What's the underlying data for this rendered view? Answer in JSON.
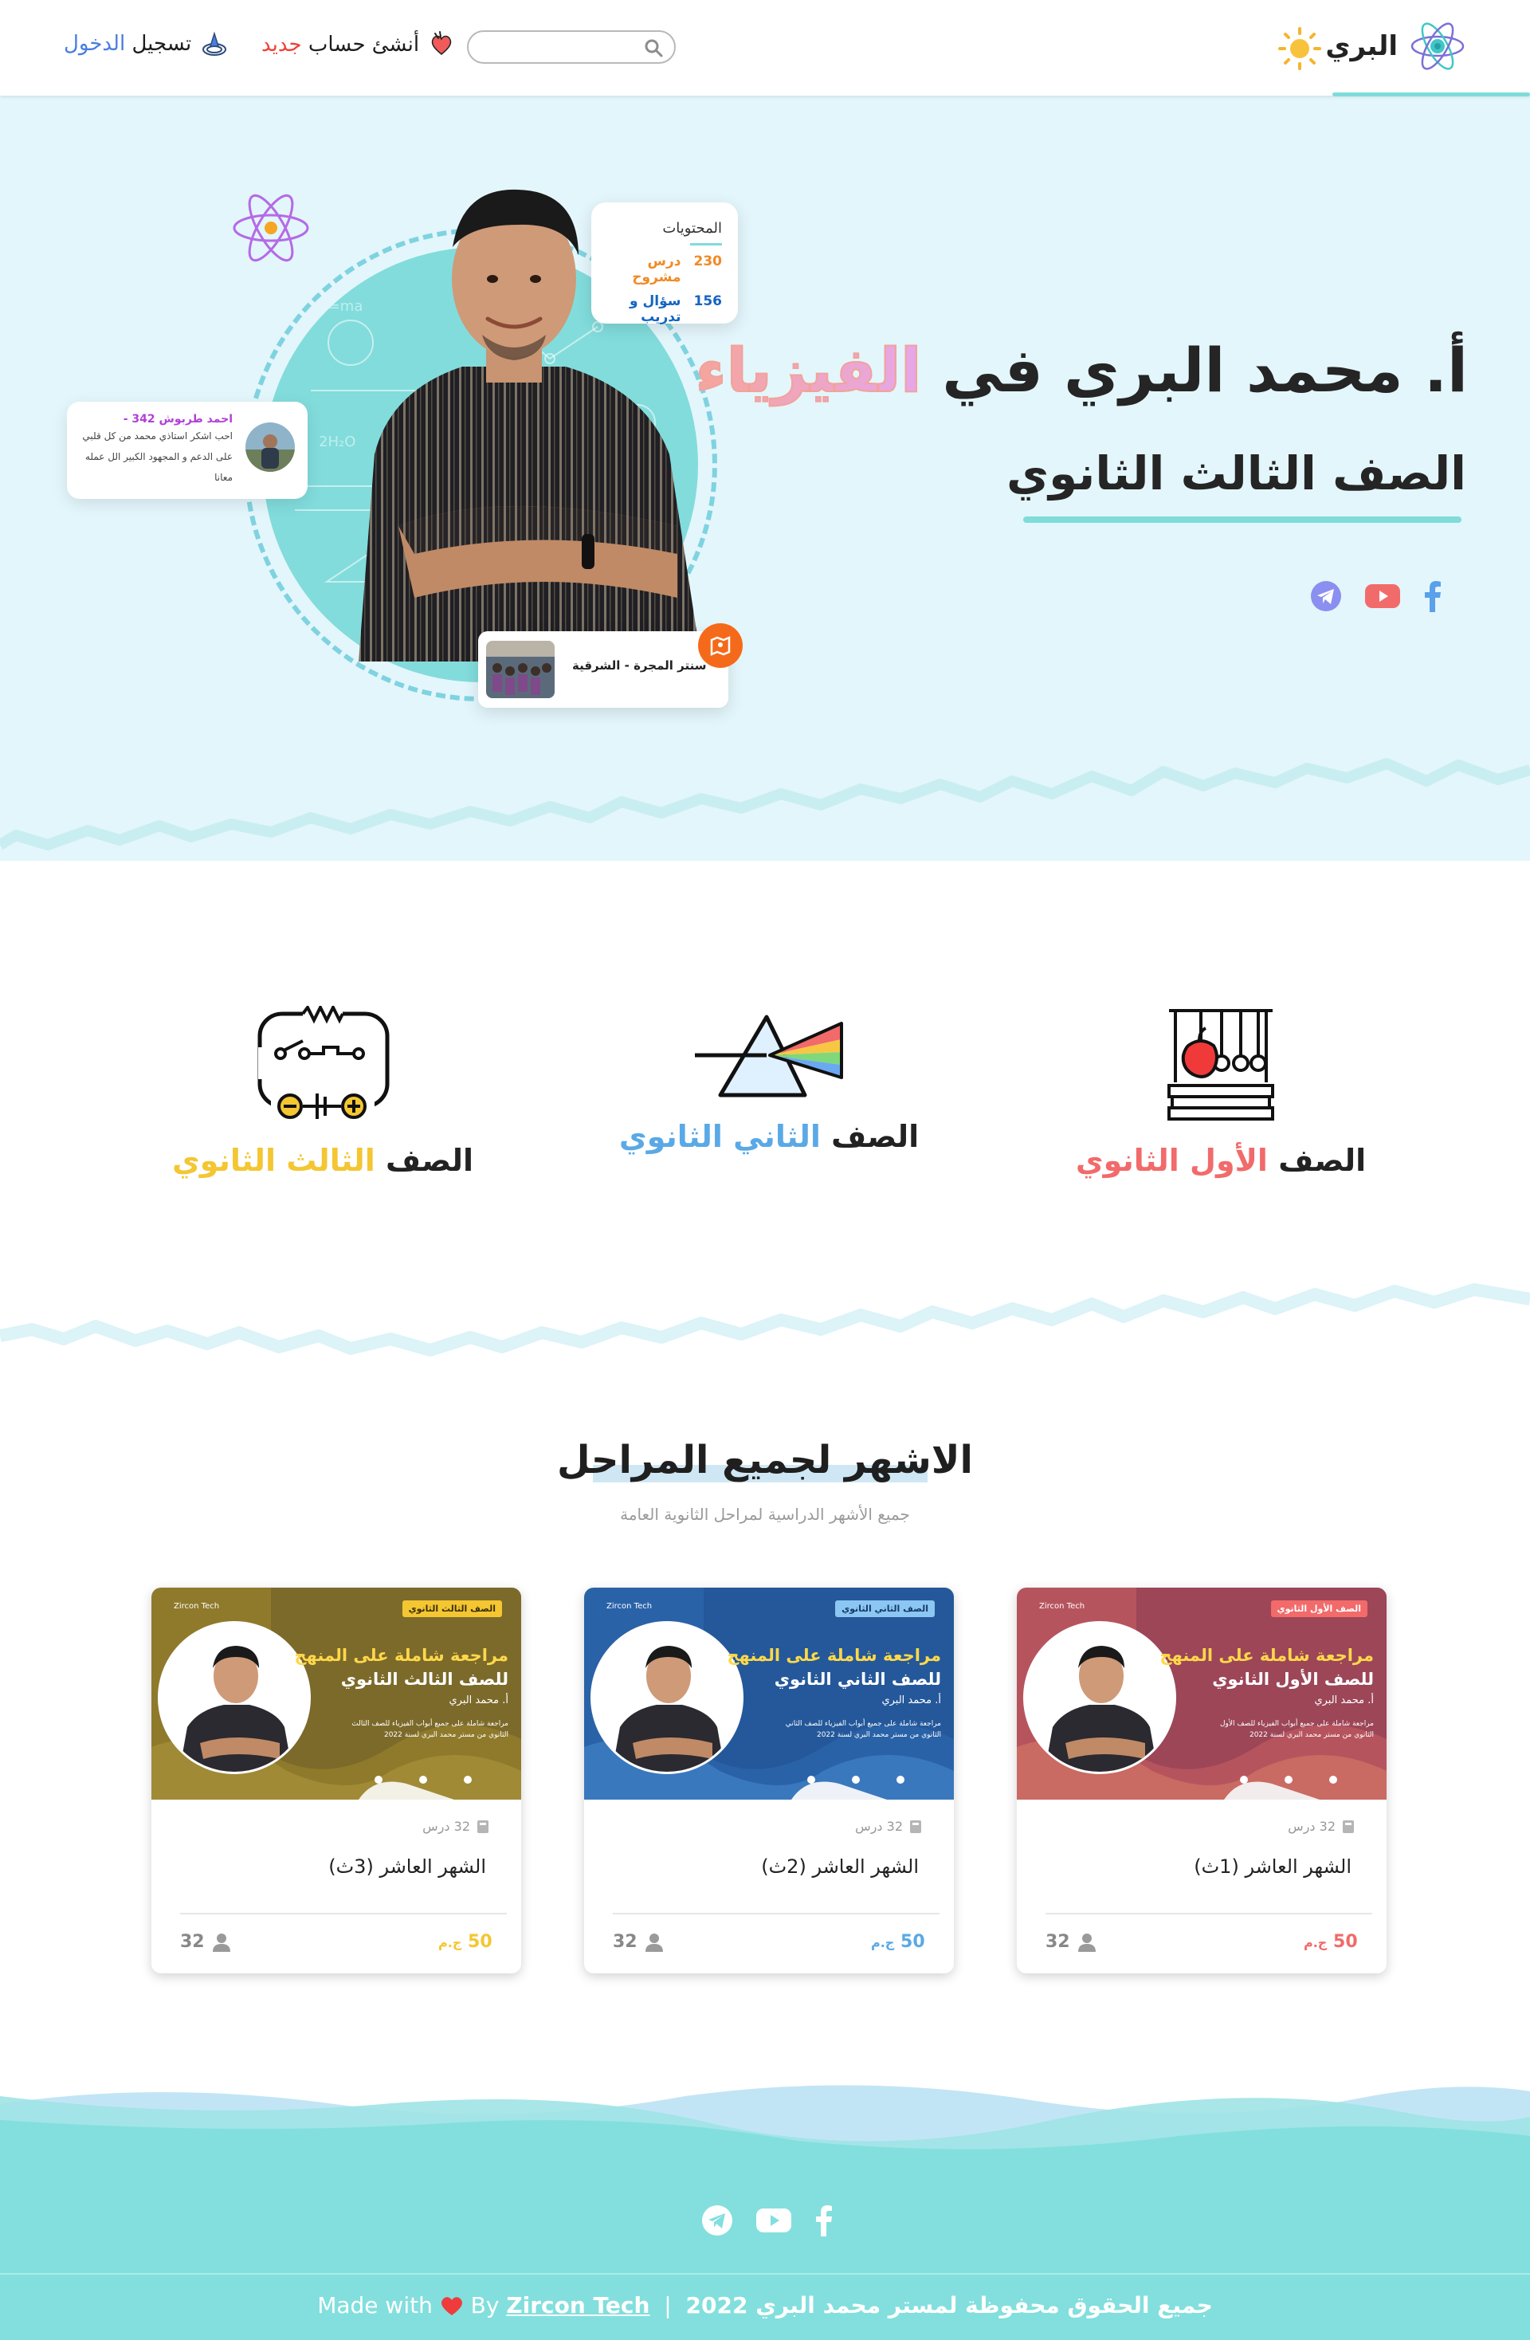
{
  "header": {
    "brand": "البري",
    "search_placeholder": "",
    "signup": {
      "text": "أنشئ حساب",
      "accent": "جديد"
    },
    "login": {
      "text": "تسجيل",
      "accent": "الدخول"
    }
  },
  "hero": {
    "title_prefix": "أ. محمد البري",
    "title_in": "في",
    "title_subject": "الفيزياء",
    "grade": "الصف الثالث الثانوي",
    "stats": {
      "title": "المحتويات",
      "rows": [
        {
          "value": "230",
          "label": "درس مشروح"
        },
        {
          "value": "156",
          "label": "سؤال و تدريب"
        }
      ]
    },
    "review": {
      "name": "احمد طربوش 342 -",
      "text": "احب اشكر استاذي محمد من كل قلبي على الدعم و المجهود الكبير الل عمله معانا"
    },
    "center": {
      "name": "سنتر المجرة - الشرقية"
    },
    "socials": [
      "facebook-icon",
      "youtube-icon",
      "telegram-icon"
    ]
  },
  "grades": [
    {
      "prefix": "الصف",
      "accent": "الأول الثانوي",
      "color": "#f26a6a"
    },
    {
      "prefix": "الصف",
      "accent": "الثاني الثانوي",
      "color": "#5aa9e6"
    },
    {
      "prefix": "الصف",
      "accent": "الثالث الثانوي",
      "color": "#f4c632"
    }
  ],
  "courses_section": {
    "title": "الاشهر لجميع المراحل",
    "subtitle": "جميع الأشهر الدراسية لمراحل الثانوية العامة"
  },
  "courses": [
    {
      "tag": "الصف الأول الثانوي",
      "brand": "Zircon Tech",
      "banner_line1": "مراجعة شاملة على المنهج",
      "banner_line2": "للصف الأول الثانوي",
      "teacher": "أ. محمد البري",
      "desc": "مراجعة شاملة على جميع أبواب الفيزياء للصف الأول الثانوي من مستر محمد البري لسنة 2022",
      "lessons": "32 درس",
      "title": "الشهر العاشر (1ث)",
      "price": "50",
      "currency": "ج.م",
      "students": "32",
      "accent": "#f26a6a"
    },
    {
      "tag": "الصف الثاني الثانوي",
      "brand": "Zircon Tech",
      "banner_line1": "مراجعة شاملة على المنهج",
      "banner_line2": "للصف الثاني الثانوي",
      "teacher": "أ. محمد البري",
      "desc": "مراجعة شاملة على جميع أبواب الفيزياء للصف الثاني الثانوي من مستر محمد البري لسنة 2022",
      "lessons": "32 درس",
      "title": "الشهر العاشر (2ث)",
      "price": "50",
      "currency": "ج.م",
      "students": "32",
      "accent": "#5aa9e6"
    },
    {
      "tag": "الصف الثالث الثانوي",
      "brand": "Zircon Tech",
      "banner_line1": "مراجعة شاملة على المنهج",
      "banner_line2": "للصف الثالث الثانوي",
      "teacher": "أ. محمد البري",
      "desc": "مراجعة شاملة على جميع أبواب الفيزياء للصف الثالث الثانوي من مستر محمد البري لسنة 2022",
      "lessons": "32 درس",
      "title": "الشهر العاشر (3ث)",
      "price": "50",
      "currency": "ج.م",
      "students": "32",
      "accent": "#f4c632"
    }
  ],
  "footer": {
    "rights": "جميع الحقوق محفوظة لمستر محمد البري 2022",
    "separator": "|",
    "made_with": "Made with",
    "by": "By",
    "company": "Zircon Tech"
  },
  "colors": {
    "teal": "#7fdcd9",
    "hero_bg": "#e3f6fb",
    "footer_bg": "#82dfdd"
  }
}
